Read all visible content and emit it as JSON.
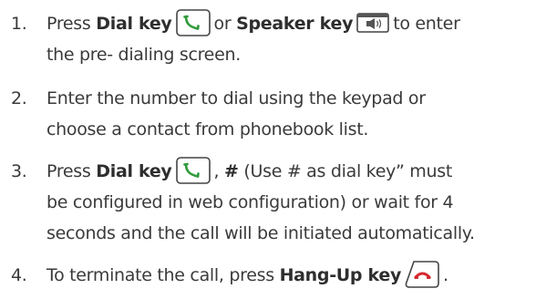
{
  "steps": [
    {
      "number": "1.",
      "press": "Press",
      "dial_key": "Dial key",
      "or": "or",
      "speaker_key": "Speaker key",
      "tail": "to enter",
      "line2": "the pre- dialing screen."
    },
    {
      "number": "2.",
      "line1": "Enter the number to dial using the keypad or",
      "line2": "choose a contact from phonebook list."
    },
    {
      "number": "3.",
      "press": "Press",
      "dial_key": "Dial key",
      "comma": ",",
      "hash": "#",
      "after_hash": "(Use # as dial key” must",
      "line2": "be configured in web configuration) or wait for 4",
      "line3": "seconds and the call will be initiated automatically."
    },
    {
      "number": "4.",
      "lead": "To terminate the call, press",
      "hangup_key": "Hang-Up key",
      "period": "."
    }
  ],
  "icons": {
    "dial": "dial-key-icon",
    "speaker": "speaker-key-icon",
    "hangup": "hang-up-key-icon"
  },
  "colors": {
    "text": "#3a3a3a",
    "icon_stroke": "#444444",
    "dial_handset": "#2f9a3a",
    "hangup_handset": "#d7282f"
  }
}
